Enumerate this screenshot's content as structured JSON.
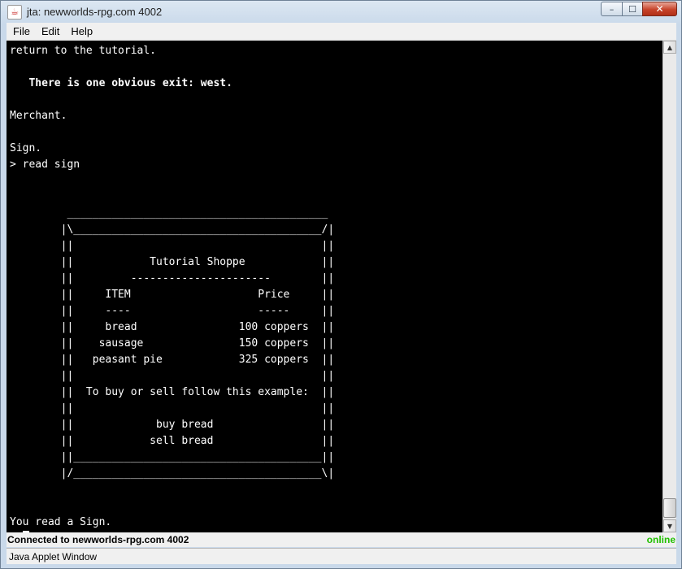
{
  "window": {
    "title": "jta: newworlds-rpg.com 4002",
    "icon": "java-cup-icon",
    "controls": {
      "minimize_glyph": "–",
      "maximize_glyph": "☐",
      "close_glyph": "✕"
    }
  },
  "menu": {
    "file": "File",
    "edit": "Edit",
    "help": "Help"
  },
  "terminal": {
    "lines": [
      {
        "text": "return to the tutorial.",
        "bold": false
      },
      {
        "text": "",
        "bold": false
      },
      {
        "text": "   There is one obvious exit: west.",
        "bold": true
      },
      {
        "text": "",
        "bold": false
      },
      {
        "text": "Merchant.",
        "bold": false
      },
      {
        "text": "",
        "bold": false
      },
      {
        "text": "Sign.",
        "bold": false
      },
      {
        "text": "> read sign",
        "bold": false
      },
      {
        "text": "",
        "bold": false
      },
      {
        "text": "",
        "bold": false
      },
      {
        "text": "         _________________________________________",
        "bold": false
      },
      {
        "text": "        |\\_______________________________________/|",
        "bold": false
      },
      {
        "text": "        ||                                       ||",
        "bold": false
      },
      {
        "text": "        ||            Tutorial Shoppe            ||",
        "bold": false
      },
      {
        "text": "        ||         ----------------------        ||",
        "bold": false
      },
      {
        "text": "        ||     ITEM                    Price     ||",
        "bold": false
      },
      {
        "text": "        ||     ----                    -----     ||",
        "bold": false
      },
      {
        "text": "        ||     bread                100 coppers  ||",
        "bold": false
      },
      {
        "text": "        ||    sausage               150 coppers  ||",
        "bold": false
      },
      {
        "text": "        ||   peasant pie            325 coppers  ||",
        "bold": false
      },
      {
        "text": "        ||                                       ||",
        "bold": false
      },
      {
        "text": "        ||  To buy or sell follow this example:  ||",
        "bold": false
      },
      {
        "text": "        ||                                       ||",
        "bold": false
      },
      {
        "text": "        ||             buy bread                 ||",
        "bold": false
      },
      {
        "text": "        ||            sell bread                 ||",
        "bold": false
      },
      {
        "text": "        ||_______________________________________||",
        "bold": false
      },
      {
        "text": "        |/_______________________________________\\|",
        "bold": false
      },
      {
        "text": "",
        "bold": false
      },
      {
        "text": "",
        "bold": false
      },
      {
        "text": "You read a Sign.",
        "bold": false
      }
    ],
    "prompt": "> "
  },
  "status": {
    "connection": "Connected to newworlds-rpg.com 4002",
    "state": "online",
    "state_color": "#22c000"
  },
  "applet_label": "Java Applet Window"
}
